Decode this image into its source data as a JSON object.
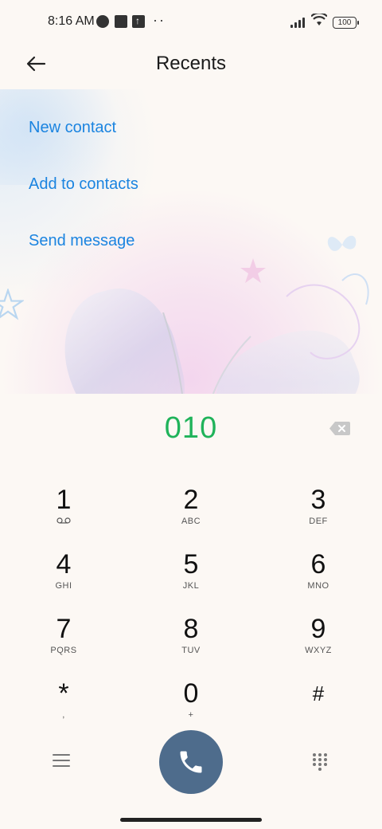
{
  "status_bar": {
    "time": "8:16 AM",
    "battery": "100"
  },
  "header": {
    "title": "Recents"
  },
  "actions": {
    "new_contact": "New contact",
    "add_to_contacts": "Add to contacts",
    "send_message": "Send message"
  },
  "dialer": {
    "number": "010",
    "keys": [
      {
        "digit": "1",
        "letters": ""
      },
      {
        "digit": "2",
        "letters": "ABC"
      },
      {
        "digit": "3",
        "letters": "DEF"
      },
      {
        "digit": "4",
        "letters": "GHI"
      },
      {
        "digit": "5",
        "letters": "JKL"
      },
      {
        "digit": "6",
        "letters": "MNO"
      },
      {
        "digit": "7",
        "letters": "PQRS"
      },
      {
        "digit": "8",
        "letters": "TUV"
      },
      {
        "digit": "9",
        "letters": "WXYZ"
      },
      {
        "digit": "*",
        "letters": ","
      },
      {
        "digit": "0",
        "letters": "+"
      },
      {
        "digit": "#",
        "letters": ""
      }
    ]
  },
  "colors": {
    "accent": "#1b84e0",
    "number": "#1fb35a",
    "call": "#4e6c8c"
  },
  "icons": [
    "back-arrow-icon",
    "voicemail-icon",
    "backspace-icon",
    "menu-icon",
    "phone-icon",
    "dialpad-icon"
  ]
}
